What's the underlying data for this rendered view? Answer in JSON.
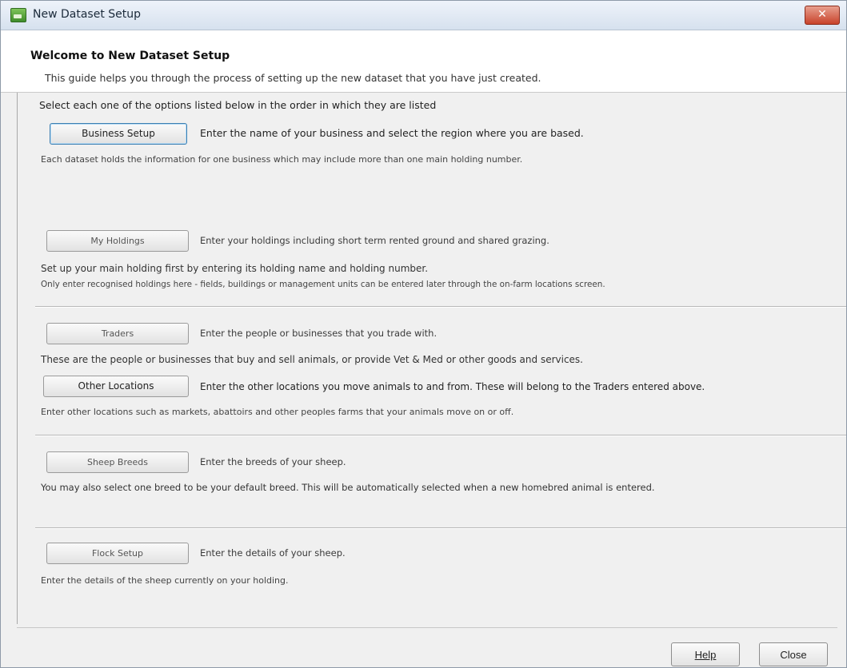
{
  "window": {
    "title": "New Dataset Setup",
    "close_glyph": "✕"
  },
  "header": {
    "welcome": "Welcome to New Dataset Setup",
    "subtitle": "This guide helps you through the process of setting up the new dataset that you have just created."
  },
  "intro": "Select each one of the options listed below in the order in which they are listed",
  "steps": {
    "business": {
      "button": "Business Setup",
      "desc": "Enter the name of your business and select the region where you are based.",
      "note1": "Each dataset holds the information for one business which may include more than one main holding number."
    },
    "holdings": {
      "button": "My Holdings",
      "desc": "Enter your holdings including short term rented ground and shared grazing.",
      "note1": "Set up your main holding first by entering its holding name and holding number.",
      "note2": "Only enter recognised holdings here - fields, buildings or management units can be entered later through the on-farm locations screen."
    },
    "traders": {
      "button": "Traders",
      "desc": "Enter the people or businesses that you trade with.",
      "note1": "These are the people or businesses that buy and sell animals, or provide Vet & Med or other goods and services."
    },
    "locations": {
      "button": "Other Locations",
      "desc": "Enter the other locations you move animals to and from. These will belong to the Traders entered above.",
      "note1": "Enter other locations such as markets, abattoirs and other peoples farms that your animals move on or off."
    },
    "breeds": {
      "button": "Sheep Breeds",
      "desc": "Enter the breeds of your sheep.",
      "note1": "You may also select one breed to be your default breed. This will be automatically selected when a new homebred animal is entered."
    },
    "flock": {
      "button": "Flock Setup",
      "desc": "Enter the details of your sheep.",
      "note1": "Enter the details of the sheep currently on your holding."
    }
  },
  "footer": {
    "help": "Help",
    "close": "Close"
  },
  "icons": {
    "app": "app-icon",
    "close": "close-icon"
  },
  "colors": {
    "focus_border": "#3c7fb1",
    "close_button": "#c8432b"
  }
}
